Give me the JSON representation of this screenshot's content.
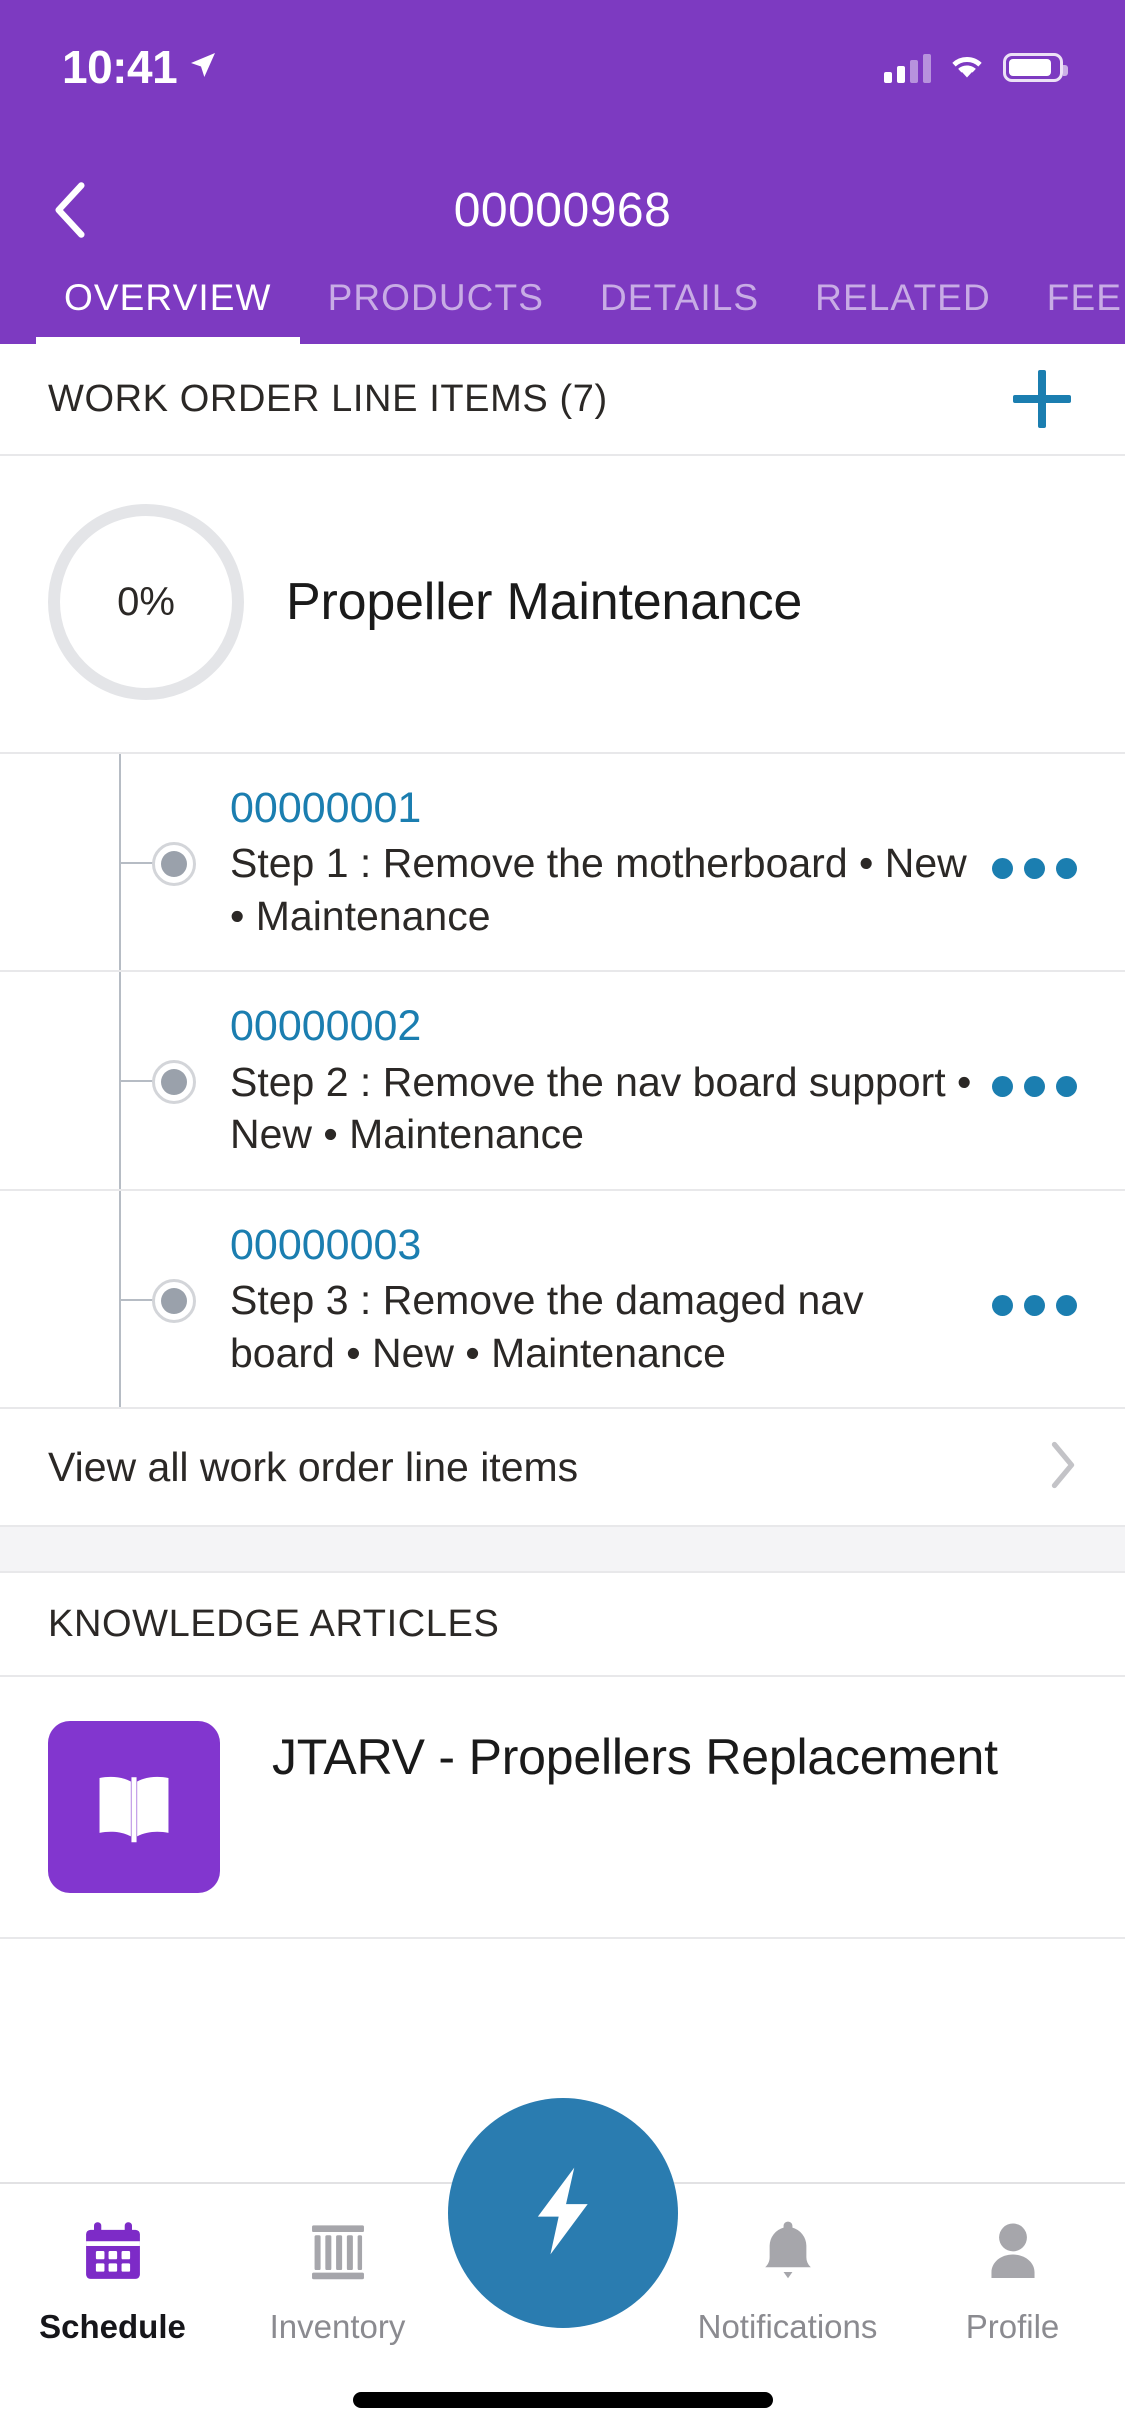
{
  "status_bar": {
    "time": "10:41",
    "location_icon": "location-arrow-icon",
    "signal_icon": "cellular-signal-icon",
    "wifi_icon": "wifi-icon",
    "battery_icon": "battery-icon"
  },
  "nav": {
    "back_icon": "chevron-left-icon",
    "title": "00000968"
  },
  "tabs": [
    {
      "label": "OVERVIEW",
      "active": true
    },
    {
      "label": "PRODUCTS",
      "active": false
    },
    {
      "label": "DETAILS",
      "active": false
    },
    {
      "label": "RELATED",
      "active": false
    },
    {
      "label": "FEED",
      "active": false
    }
  ],
  "line_items_section": {
    "header": "WORK ORDER LINE ITEMS (7)",
    "add_icon": "plus-icon",
    "progress": {
      "percent_label": "0%",
      "title": "Propeller Maintenance"
    },
    "items": [
      {
        "code": "00000001",
        "description": "Step 1 : Remove the motherboard • New • Maintenance",
        "menu_icon": "overflow-menu-icon",
        "status_icon": "status-dot-icon"
      },
      {
        "code": "00000002",
        "description": "Step 2 : Remove the nav board support • New • Maintenance",
        "menu_icon": "overflow-menu-icon",
        "status_icon": "status-dot-icon"
      },
      {
        "code": "00000003",
        "description": "Step 3 : Remove the damaged nav board • New • Maintenance",
        "menu_icon": "overflow-menu-icon",
        "status_icon": "status-dot-icon"
      }
    ],
    "view_all": {
      "label": "View all work order line items",
      "chevron_icon": "chevron-right-icon"
    }
  },
  "knowledge_section": {
    "header": "KNOWLEDGE ARTICLES",
    "articles": [
      {
        "icon": "book-icon",
        "title": "JTARV  - Propellers Replacement"
      }
    ]
  },
  "bottom_nav": {
    "items": [
      {
        "label": "Schedule",
        "icon": "calendar-icon",
        "active": true
      },
      {
        "label": "Inventory",
        "icon": "inventory-icon",
        "active": false
      },
      {
        "label": "Notifications",
        "icon": "bell-icon",
        "active": false
      },
      {
        "label": "Profile",
        "icon": "person-icon",
        "active": false
      }
    ],
    "fab": {
      "icon": "lightning-bolt-icon"
    }
  },
  "colors": {
    "brand_purple": "#7d3ac1",
    "link_blue": "#1b7eb0",
    "fab_blue": "#2a7cb0",
    "article_purple": "#8236cf"
  }
}
